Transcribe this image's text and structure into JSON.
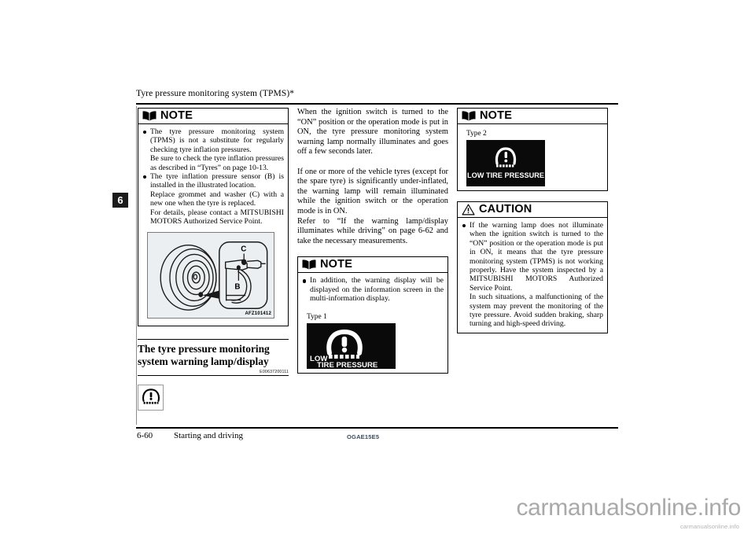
{
  "page": {
    "header_title": "Tyre pressure monitoring system (TPMS)*",
    "chapter_number": "6",
    "footer": {
      "page_number": "6-60",
      "section_name": "Starting and driving",
      "document_code": "OGAE15E5"
    }
  },
  "watermark": {
    "primary": "carmanualsonline.info",
    "secondary": "carmanualsonline.info"
  },
  "left_column": {
    "note": {
      "label": "NOTE",
      "icon": "note-book-icon",
      "bullets": [
        {
          "main": "The tyre pressure monitoring system (TPMS) is not a substitute for regularly checking tyre inflation pressures.",
          "subs": [
            "Be sure to check the tyre inflation pressures as described in “Tyres” on page 10-13."
          ]
        },
        {
          "main": "The tyre inflation pressure sensor (B) is installed in the illustrated location.",
          "subs": [
            "Replace grommet and washer (C) with a new one when the tyre is replaced.",
            "For details, please contact a MITSUBISHI MOTORS Authorized Service Point."
          ]
        }
      ],
      "figure": {
        "name": "tyre-pressure-sensor-illustration",
        "code": "AFZ101412",
        "callout_labels": [
          "C",
          "B"
        ]
      }
    },
    "section": {
      "heading": "The tyre pressure monitoring system warning lamp/display",
      "reference_code": "E00637200111",
      "lamp_icon": "tpms-warning-lamp-icon"
    }
  },
  "middle_column": {
    "paragraphs": [
      "When the ignition switch is turned to the “ON” position or the operation mode is put in ON, the tyre pressure monitoring system warning lamp normally illuminates and goes off a few seconds later.",
      "If one or more of the vehicle tyres (except for the spare tyre) is significantly under-inflated, the warning lamp will remain illuminated while the ignition switch or the operation mode is in ON.",
      "Refer to “If the warning lamp/display illuminates while driving” on page 6-62 and take the necessary measurements."
    ],
    "note": {
      "label": "NOTE",
      "icon": "note-book-icon",
      "bullets": [
        {
          "main": "In addition, the warning display will be displayed on the information screen in the multi-information display.",
          "subs": []
        }
      ],
      "display": {
        "type_label": "Type 1",
        "screen_line1": "LOW",
        "screen_line2": "TIRE PRESSURE",
        "icon": "tpms-warning-lamp-icon"
      }
    }
  },
  "right_column": {
    "note": {
      "label": "NOTE",
      "icon": "note-book-icon",
      "display": {
        "type_label": "Type 2",
        "screen_line1": "LOW TIRE PRESSURE",
        "icon": "tpms-warning-lamp-icon"
      }
    },
    "caution": {
      "label": "CAUTION",
      "icon": "warning-triangle-icon",
      "bullets": [
        {
          "main": "If the warning lamp does not illuminate when the ignition switch is turned to the “ON” position or the operation mode is put in ON, it means that the tyre pressure monitoring system (TPMS) is not working properly. Have the system inspected by a MITSUBISHI MOTORS Authorized Service Point.",
          "subs": [
            "In such situations, a malfunctioning of the system may prevent the monitoring of the tyre pressure. Avoid sudden braking, sharp turning and high-speed driving."
          ]
        }
      ]
    }
  },
  "colors": {
    "ink": "#000000",
    "figure_bg": "#eceff1",
    "display_bg": "#0a0a0a",
    "watermark": "#a9a9a9",
    "footer_code": "#3b4a5a"
  }
}
